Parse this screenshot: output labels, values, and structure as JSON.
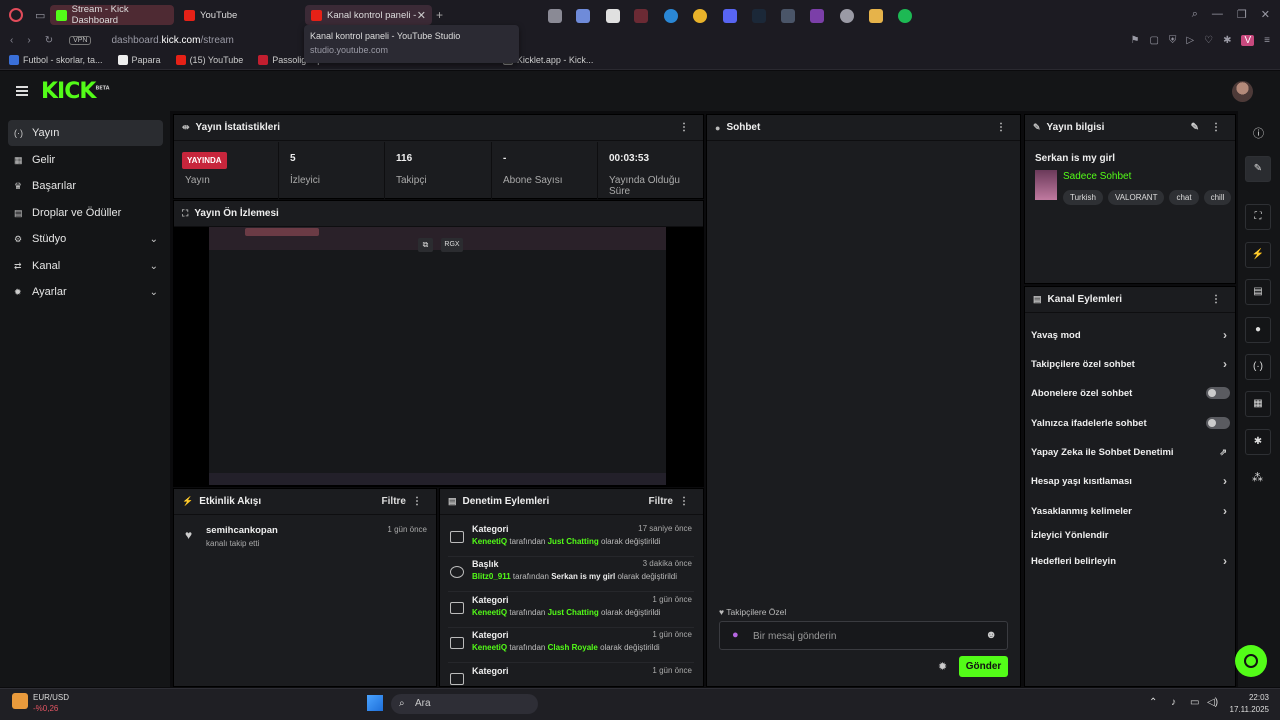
{
  "browser": {
    "tabs": [
      "Stream - Kick Dashboard",
      "YouTube",
      "Kanal kontrol paneli -"
    ],
    "url_prefix": "dashboard.",
    "url_domain": "kick.com",
    "url_path": "/stream",
    "vpn_label": "VPN",
    "tooltip_title": "Kanal kontrol paneli - YouTube Studio",
    "tooltip_sub": "studio.youtube.com",
    "bookmarks": [
      "Futbol - skorlar, ta...",
      "Papara",
      "(15) YouTube",
      "Passolig: Spo",
      "k",
      "Kicklet.app - Kick..."
    ]
  },
  "header": {
    "logo": "KICK",
    "logo_sup": "BETA"
  },
  "sidebar": {
    "items": [
      {
        "label": "Yayın",
        "icon": "(·)"
      },
      {
        "label": "Gelir",
        "icon": "▦"
      },
      {
        "label": "Başarılar",
        "icon": "♛"
      },
      {
        "label": "Droplar ve Ödüller",
        "icon": "▤"
      },
      {
        "label": "Stüdyo",
        "icon": "⚙"
      },
      {
        "label": "Kanal",
        "icon": "⇄"
      },
      {
        "label": "Ayarlar",
        "icon": "✹"
      }
    ]
  },
  "stats": {
    "title": "Yayın İstatistikleri",
    "live_badge": "YAYINDA",
    "live_label": "Yayın",
    "items": [
      {
        "value": "5",
        "label": "İzleyici"
      },
      {
        "value": "116",
        "label": "Takipçi"
      },
      {
        "value": "-",
        "label": "Abone Sayısı"
      },
      {
        "value": "00:03:53",
        "label": "Yayında Olduğu",
        "label2": "Süre"
      }
    ]
  },
  "preview": {
    "title": "Yayın Ön İzlemesi",
    "rgx": "RGX"
  },
  "activity": {
    "title": "Etkinlik Akışı",
    "filter": "Filtre",
    "items": [
      {
        "name": "semihcankopan",
        "sub": "kanalı takip etti",
        "time": "1 gün önce"
      }
    ]
  },
  "moderation": {
    "title": "Denetim Eylemleri",
    "filter": "Filtre",
    "items": [
      {
        "type": "Kategori",
        "time": "17 saniye önce",
        "user": "KeneetiQ",
        "mid": " tarafından ",
        "value": "Just Chatting",
        "value_color": "green",
        "end": " olarak değiştirildi"
      },
      {
        "type": "Başlık",
        "time": "3 dakika önce",
        "user": "Blitz0_911",
        "mid": " tarafından ",
        "value": "Serkan is my girl",
        "value_color": "white",
        "end": " olarak değiştirildi"
      },
      {
        "type": "Kategori",
        "time": "1 gün önce",
        "user": "KeneetiQ",
        "mid": " tarafından ",
        "value": "Just Chatting",
        "value_color": "green",
        "end": " olarak değiştirildi"
      },
      {
        "type": "Kategori",
        "time": "1 gün önce",
        "user": "KeneetiQ",
        "mid": " tarafından ",
        "value": "Clash Royale",
        "value_color": "green",
        "end": " olarak değiştirildi"
      },
      {
        "type": "Kategori",
        "time": "1 gün önce",
        "user": "",
        "mid": "",
        "value": "",
        "value_color": "green",
        "end": ""
      }
    ]
  },
  "chat": {
    "title": "Sohbet",
    "mode": "Takipçilere Özel",
    "placeholder": "Bir mesaj gönderin",
    "send": "Gönder"
  },
  "stream_info": {
    "title": "Yayın bilgisi",
    "stream_title": "Serkan is my girl",
    "category": "Sadece Sohbet",
    "tags": [
      "Turkish",
      "VALORANT",
      "chat",
      "chill"
    ]
  },
  "channel_actions": {
    "title": "Kanal Eylemleri",
    "items": [
      {
        "label": "Yavaş mod",
        "control": "chevron"
      },
      {
        "label": "Takipçilere özel sohbet",
        "control": "chevron"
      },
      {
        "label": "Abonelere özel sohbet",
        "control": "toggle"
      },
      {
        "label": "Yalnızca ifadelerle sohbet",
        "control": "toggle"
      },
      {
        "label": "Yapay Zeka ile Sohbet Denetimi",
        "control": "external"
      },
      {
        "label": "Hesap yaşı kısıtlaması",
        "control": "chevron"
      },
      {
        "label": "Yasaklanmış kelimeler",
        "control": "chevron"
      },
      {
        "label": "İzleyici Yönlendir",
        "control": "none"
      },
      {
        "label": "Hedefleri belirleyin",
        "control": "chevron"
      }
    ]
  },
  "taskbar": {
    "weather_label": "EUR/USD",
    "weather_value": "-%0,26",
    "search": "Ara",
    "time": "22:03",
    "date": "17.11.2025"
  },
  "colors": {
    "accent": "#53fc18",
    "live": "#c7263c",
    "bg": "#1b1c1f"
  }
}
